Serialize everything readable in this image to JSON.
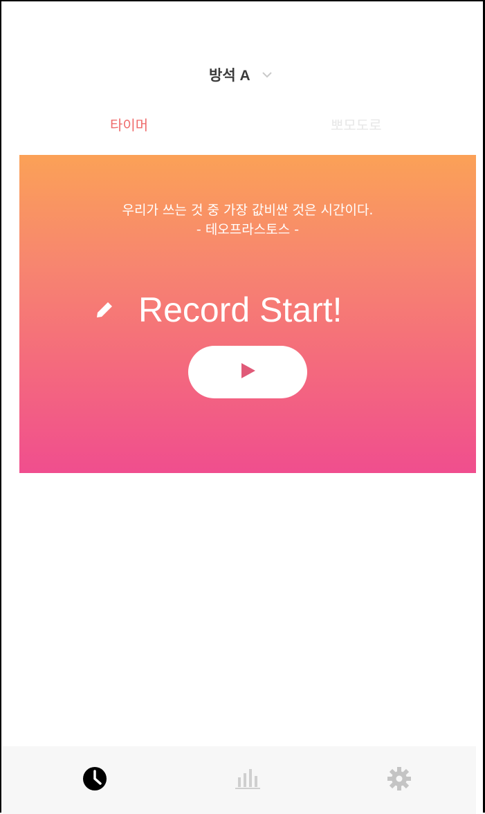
{
  "header": {
    "room_title": "방석 A",
    "room_dropdown_icon": "chevron-down-icon"
  },
  "tabs": [
    {
      "label": "타이머",
      "active": true,
      "color": "#ef6b6b"
    },
    {
      "label": "뽀모도로",
      "active": false,
      "color": "#e7e7e7"
    }
  ],
  "hero": {
    "gradient_colors": [
      "#fba157",
      "#f7866f",
      "#f46a7d",
      "#f04e8e"
    ],
    "quote": "우리가 쓰는 것 중 가장 값비싼 것은 시간이다.",
    "quote_author": "- 테오프라스토스 -",
    "record_icon": "pencil-icon",
    "record_label": "Record Start!",
    "play_icon": "play-icon",
    "play_icon_color": "#e05a78"
  },
  "bottom_nav": {
    "items": [
      {
        "icon": "clock-icon",
        "active": true
      },
      {
        "icon": "bar-chart-icon",
        "active": false
      },
      {
        "icon": "gear-icon",
        "active": false
      }
    ]
  }
}
